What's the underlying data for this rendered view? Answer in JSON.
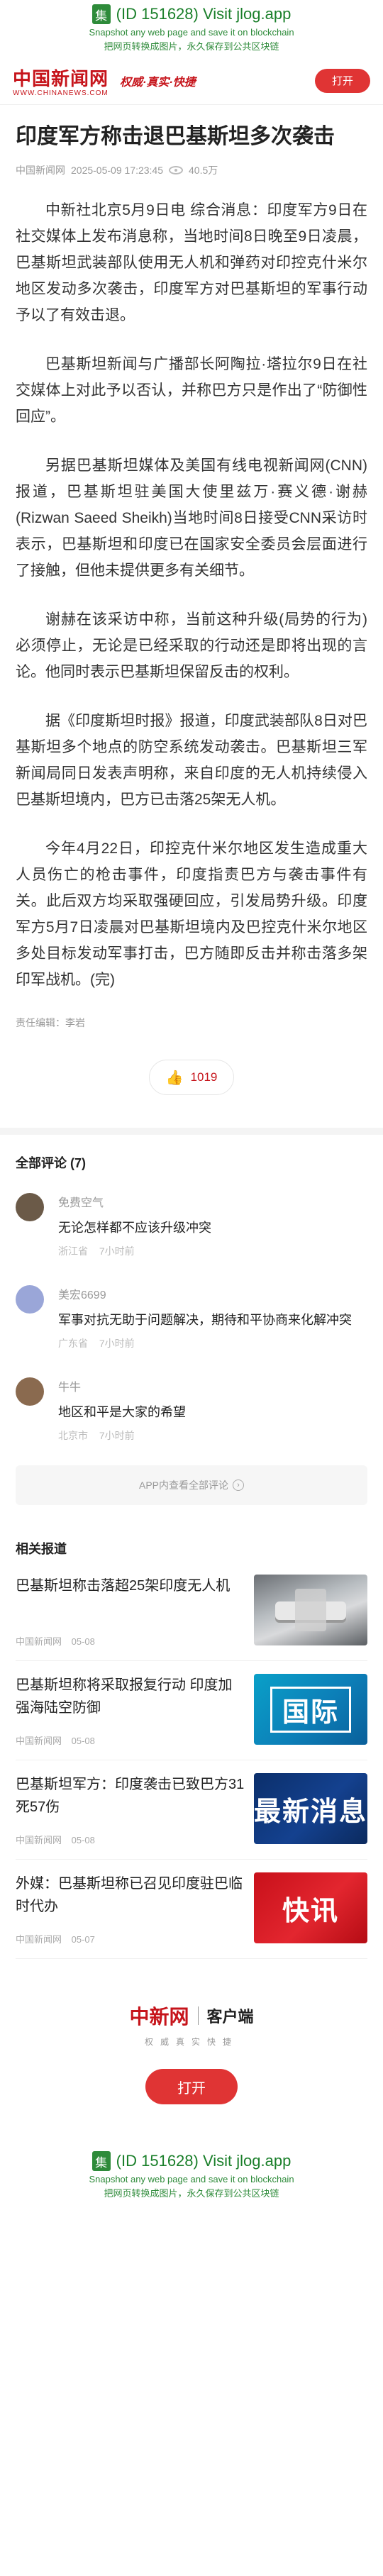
{
  "jlog_top": {
    "icon_char": "集",
    "line1": "(ID 151628) Visit jlog.app",
    "line2": "Snapshot any web page and save it on blockchain",
    "line3": "把网页转换成图片，永久保存到公共区块链"
  },
  "header": {
    "logo_cn": "中国新闻网",
    "logo_en": "WWW.CHINANEWS.COM",
    "slogan": "权威·真实·快捷",
    "open_label": "打开"
  },
  "article": {
    "title": "印度军方称击退巴基斯坦多次袭击",
    "source": "中国新闻网",
    "datetime": "2025-05-09 17:23:45",
    "views": "40.5万",
    "paragraphs": [
      "中新社北京5月9日电 综合消息：印度军方9日在社交媒体上发布消息称，当地时间8日晚至9日凌晨，巴基斯坦武装部队使用无人机和弹药对印控克什米尔地区发动多次袭击，印度军方对巴基斯坦的军事行动予以了有效击退。",
      "巴基斯坦新闻与广播部长阿陶拉·塔拉尔9日在社交媒体上对此予以否认，并称巴方只是作出了“防御性回应”。",
      "另据巴基斯坦媒体及美国有线电视新闻网(CNN)报道，巴基斯坦驻美国大使里兹万·赛义德·谢赫(Rizwan Saeed Sheikh)当地时间8日接受CNN采访时表示，巴基斯坦和印度已在国家安全委员会层面进行了接触，但他未提供更多有关细节。",
      "谢赫在该采访中称，当前这种升级(局势的行为)必须停止，无论是已经采取的行动还是即将出现的言论。他同时表示巴基斯坦保留反击的权利。",
      "据《印度斯坦时报》报道，印度武装部队8日对巴基斯坦多个地点的防空系统发动袭击。巴基斯坦三军新闻局同日发表声明称，来自印度的无人机持续侵入巴基斯坦境内，巴方已击落25架无人机。",
      "今年4月22日，印控克什米尔地区发生造成重大人员伤亡的枪击事件，印度指责巴方与袭击事件有关。此后双方均采取强硬回应，引发局势升级。印度军方5月7日凌晨对巴基斯坦境内及巴控克什米尔地区多处目标发动军事打击，巴方随即反击并称击落多架印军战机。(完)"
    ],
    "editor": "责任编辑：李岩",
    "likes": "1019"
  },
  "comments": {
    "section_title": "全部评论 (7)",
    "items": [
      {
        "name": "免费空气",
        "text": "无论怎样都不应该升级冲突",
        "location": "浙江省",
        "time": "7小时前",
        "avatar_color": "#6b5a48"
      },
      {
        "name": "美宏6699",
        "text": "军事对抗无助于问题解决，期待和平协商来化解冲突",
        "location": "广东省",
        "time": "7小时前",
        "avatar_color": "#9aa6d8"
      },
      {
        "name": "牛牛",
        "text": "地区和平是大家的希望",
        "location": "北京市",
        "time": "7小时前",
        "avatar_color": "#8a6a4f"
      }
    ],
    "all_label": "APP内查看全部评论"
  },
  "related": {
    "section_title": "相关报道",
    "items": [
      {
        "title": "巴基斯坦称击落超25架印度无人机",
        "source": "中国新闻网",
        "date": "05-08",
        "thumb_word": "",
        "thumb_style": "photo"
      },
      {
        "title": "巴基斯坦称将采取报复行动 印度加强海陆空防御",
        "source": "中国新闻网",
        "date": "05-08",
        "thumb_word": "国际",
        "thumb_style": "blue"
      },
      {
        "title": "巴基斯坦军方：印度袭击已致巴方31死57伤",
        "source": "中国新闻网",
        "date": "05-08",
        "thumb_word": "最新消息",
        "thumb_style": "darkblue"
      },
      {
        "title": "外媒：巴基斯坦称已召见印度驻巴临时代办",
        "source": "中国新闻网",
        "date": "05-07",
        "thumb_word": "快讯",
        "thumb_style": "red"
      }
    ]
  },
  "footer": {
    "logo_cn": "中新网",
    "client_label": "客户端",
    "slogan": "权威真实快捷",
    "open_label": "打开"
  },
  "jlog_bottom": {
    "icon_char": "集",
    "line1": "(ID 151628) Visit jlog.app",
    "line2": "Snapshot any web page and save it on blockchain",
    "line3": "把网页转换成图片，永久保存到公共区块链"
  }
}
